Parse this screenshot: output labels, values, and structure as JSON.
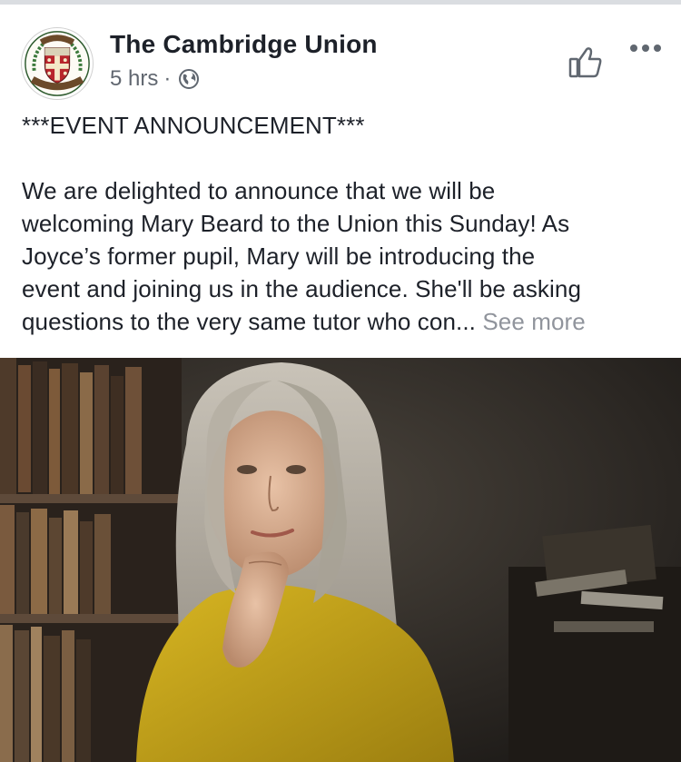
{
  "post": {
    "page_name": "The Cambridge Union",
    "time": "5 hrs",
    "separator": "·",
    "audience_icon": "globe-icon",
    "headline": "***EVENT ANNOUNCEMENT***",
    "body_lines": [
      "We are delighted to announce that we will be",
      "welcoming Mary Beard to the Union this Sunday! As",
      "Joyce’s former pupil, Mary will be introducing the",
      "event and joining us in the audience. She'll be asking",
      "questions to the very same tutor who con..."
    ],
    "see_more": "See more",
    "like_icon": "thumbs-up-icon",
    "more_icon": "more-options-icon",
    "avatar": {
      "icon": "cambridge-union-crest-icon",
      "crest_text_top": "A.D.1815",
      "crest_text_bottom": "CAMBRIDGE UNION SOCIETY"
    }
  }
}
